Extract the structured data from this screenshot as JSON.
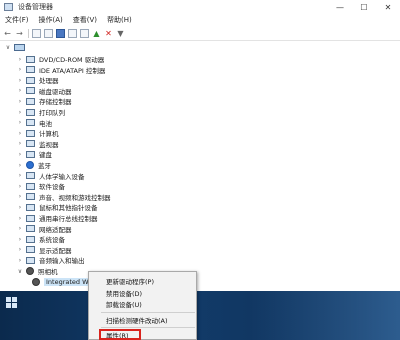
{
  "window": {
    "title": "设备管理器",
    "minimize": "—",
    "maximize": "☐",
    "close": "✕"
  },
  "menu": [
    "文件(F)",
    "操作(A)",
    "查看(V)",
    "帮助(H)"
  ],
  "toolbar_icons": [
    "back-arrow-icon",
    "forward-arrow-icon",
    "device-view-icon",
    "properties-icon",
    "help-icon",
    "scan-icon",
    "monitor-icon",
    "update-driver-icon",
    "uninstall-icon",
    "disable-icon"
  ],
  "tree": {
    "root_label": "",
    "categories": [
      {
        "label": "DVD/CD-ROM 驱动器",
        "icon": "dvd-drive-icon",
        "expanded": false
      },
      {
        "label": "IDE ATA/ATAPI 控制器",
        "icon": "ide-controller-icon",
        "expanded": false
      },
      {
        "label": "处理器",
        "icon": "processor-icon",
        "expanded": false
      },
      {
        "label": "磁盘驱动器",
        "icon": "disk-drive-icon",
        "expanded": false
      },
      {
        "label": "存储控制器",
        "icon": "storage-controller-icon",
        "expanded": false
      },
      {
        "label": "打印队列",
        "icon": "print-queue-icon",
        "expanded": false
      },
      {
        "label": "电池",
        "icon": "battery-icon",
        "expanded": false
      },
      {
        "label": "计算机",
        "icon": "computer-icon",
        "expanded": false
      },
      {
        "label": "监视器",
        "icon": "monitor-icon",
        "expanded": false
      },
      {
        "label": "键盘",
        "icon": "keyboard-icon",
        "expanded": false
      },
      {
        "label": "蓝牙",
        "icon": "bluetooth-icon",
        "expanded": false
      },
      {
        "label": "人体学输入设备",
        "icon": "hid-icon",
        "expanded": false
      },
      {
        "label": "软件设备",
        "icon": "software-device-icon",
        "expanded": false
      },
      {
        "label": "声音、视频和游戏控制器",
        "icon": "sound-icon",
        "expanded": false
      },
      {
        "label": "鼠标和其他指针设备",
        "icon": "mouse-icon",
        "expanded": false
      },
      {
        "label": "通用串行总线控制器",
        "icon": "usb-icon",
        "expanded": false
      },
      {
        "label": "网络适配器",
        "icon": "network-adapter-icon",
        "expanded": false
      },
      {
        "label": "系统设备",
        "icon": "system-device-icon",
        "expanded": false
      },
      {
        "label": "显示适配器",
        "icon": "display-adapter-icon",
        "expanded": false
      },
      {
        "label": "音频输入和输出",
        "icon": "audio-io-icon",
        "expanded": false
      },
      {
        "label": "照相机",
        "icon": "camera-icon",
        "expanded": true
      }
    ],
    "selected_device": {
      "label": "Integrated Web",
      "icon": "webcam-icon"
    }
  },
  "context_menu": {
    "items": [
      "更新驱动程序(P)",
      "禁用设备(D)",
      "卸载设备(U)",
      "扫描检测硬件改动(A)",
      "属性(R)"
    ],
    "highlighted": "属性(R)",
    "highlight_color": "#d9231d"
  },
  "taskbar": {
    "watermark": "",
    "background": "#123c6b"
  }
}
